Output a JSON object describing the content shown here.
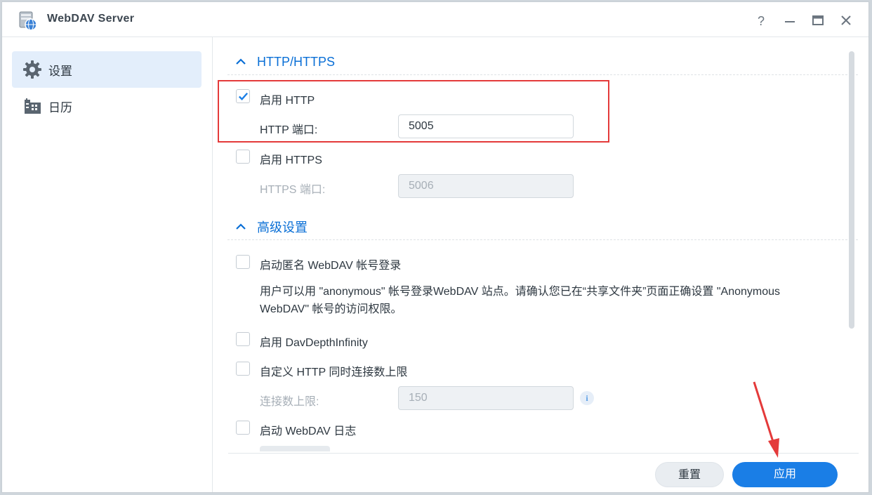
{
  "window": {
    "title": "WebDAV Server"
  },
  "sidebar": {
    "items": [
      {
        "label": "设置",
        "icon": "gear-icon",
        "active": true
      },
      {
        "label": "日历",
        "icon": "calendar-log-icon",
        "active": false
      }
    ]
  },
  "sections": {
    "http": {
      "title": "HTTP/HTTPS",
      "enable_http_label": "启用 HTTP",
      "enable_http_checked": true,
      "http_port_label": "HTTP 端口:",
      "http_port_value": "5005",
      "enable_https_label": "启用 HTTPS",
      "enable_https_checked": false,
      "https_port_label": "HTTPS 端口:",
      "https_port_value": "5006"
    },
    "advanced": {
      "title": "高级设置",
      "anonymous_label": "启动匿名 WebDAV 帐号登录",
      "anonymous_desc_line1": "用户可以用 \"anonymous\" 帐号登录WebDAV 站点。请确认您已在“共享文件夹”页面正确设置 \"Anonymous",
      "anonymous_desc_line2": "WebDAV\" 帐号的访问权限。",
      "depth_label": "启用 DavDepthInfinity",
      "custom_limit_label": "自定义 HTTP 同时连接数上限",
      "limit_label": "连接数上限:",
      "limit_value": "150",
      "log_label": "启动 WebDAV 日志"
    }
  },
  "footer": {
    "reset_label": "重置",
    "apply_label": "应用"
  },
  "colors": {
    "accent": "#1a7ee6",
    "highlight": "#e43a3a"
  }
}
